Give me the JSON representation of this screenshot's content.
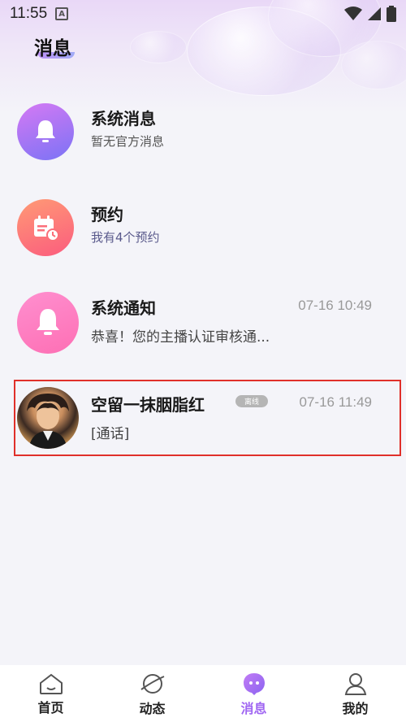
{
  "status_bar": {
    "time": "11:55",
    "notification_icon": "a-letter-icon"
  },
  "page": {
    "title": "消息"
  },
  "messages": [
    {
      "title": "系统消息",
      "subtitle": "暂无官方消息",
      "icon": "bell-icon",
      "time": ""
    },
    {
      "title": "预约",
      "subtitle": "我有4个预约",
      "icon": "calendar-icon",
      "time": ""
    },
    {
      "title": "系统通知",
      "subtitle": "恭喜！您的主播认证审核通...",
      "icon": "bell-icon",
      "time": "07-16 10:49"
    },
    {
      "title": "空留一抹胭脂红",
      "subtitle": "[通话]",
      "icon": "user-avatar",
      "time": "07-16 11:49",
      "badge": "离线"
    }
  ],
  "tabs": [
    {
      "label": "首页",
      "icon": "home-icon",
      "active": false
    },
    {
      "label": "动态",
      "icon": "planet-icon",
      "active": false
    },
    {
      "label": "消息",
      "icon": "chat-bubble-icon",
      "active": true
    },
    {
      "label": "我的",
      "icon": "profile-icon",
      "active": false
    }
  ],
  "colors": {
    "accent": "#a066f2",
    "highlight_border": "#e0302a"
  }
}
